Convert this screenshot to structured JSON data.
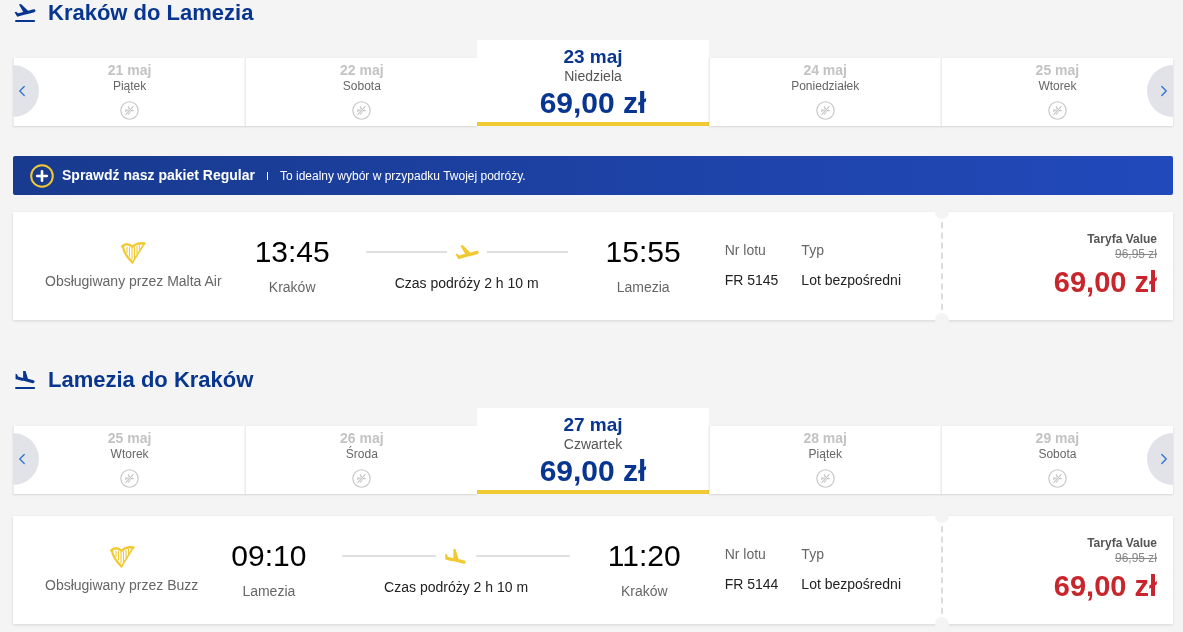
{
  "sections": [
    {
      "kind": "outbound",
      "title": "Kraków do Lamezia",
      "dates": [
        {
          "date": "21 maj",
          "day": "Piątek",
          "selected": false
        },
        {
          "date": "22 maj",
          "day": "Sobota",
          "selected": false
        },
        {
          "date": "23 maj",
          "day": "Niedziela",
          "selected": true,
          "price": "69,00 zł"
        },
        {
          "date": "24 maj",
          "day": "Poniedziałek",
          "selected": false
        },
        {
          "date": "25 maj",
          "day": "Wtorek",
          "selected": false
        }
      ],
      "promo": {
        "title": "Sprawdź nasz pakiet Regular",
        "text": "To idealny wybór w przypadku Twojej podróży."
      },
      "flight": {
        "carrier": "Obsługiwany przez Malta Air",
        "departure": {
          "time": "13:45",
          "city": "Kraków"
        },
        "duration": "Czas podróży 2 h 10 m",
        "arrival": {
          "time": "15:55",
          "city": "Lamezia"
        },
        "flight_number": {
          "label": "Nr lotu",
          "value": "FR 5145"
        },
        "type": {
          "label": "Typ",
          "value": "Lot bezpośredni"
        },
        "fare": {
          "name": "Taryfa Value",
          "old_price": "96,95 zł",
          "price": "69,00 zł"
        }
      }
    },
    {
      "kind": "inbound",
      "title": "Lamezia do Kraków",
      "dates": [
        {
          "date": "25 maj",
          "day": "Wtorek",
          "selected": false
        },
        {
          "date": "26 maj",
          "day": "Środa",
          "selected": false
        },
        {
          "date": "27 maj",
          "day": "Czwartek",
          "selected": true,
          "price": "69,00 zł"
        },
        {
          "date": "28 maj",
          "day": "Piątek",
          "selected": false
        },
        {
          "date": "29 maj",
          "day": "Sobota",
          "selected": false
        }
      ],
      "flight": {
        "carrier": "Obsługiwany przez Buzz",
        "departure": {
          "time": "09:10",
          "city": "Lamezia"
        },
        "duration": "Czas podróży 2 h 10 m",
        "arrival": {
          "time": "11:20",
          "city": "Kraków"
        },
        "flight_number": {
          "label": "Nr lotu",
          "value": "FR 5144"
        },
        "type": {
          "label": "Typ",
          "value": "Lot bezpośredni"
        },
        "fare": {
          "name": "Taryfa Value",
          "old_price": "96,95 zł",
          "price": "69,00 zł"
        }
      }
    }
  ]
}
